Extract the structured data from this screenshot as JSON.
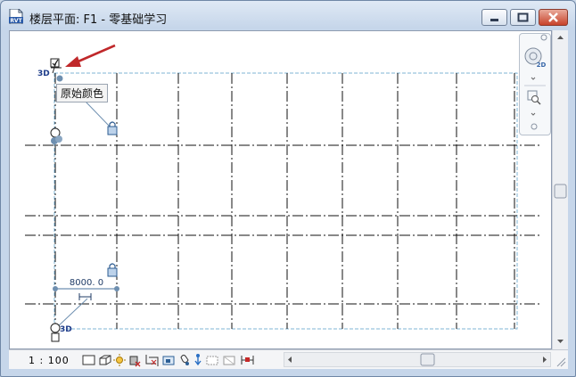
{
  "window": {
    "title": "楼层平面: F1 - 零基础学习",
    "app_icon_label": "RVT",
    "minimize_icon": "minimize-icon",
    "maximize_icon": "maximize-icon",
    "close_icon": "close-icon"
  },
  "canvas": {
    "tooltip_text": "原始颜色",
    "top_view_tag": "3D",
    "bottom_view_tag": "3D",
    "dimension_value": "8000. 0",
    "arrow_color": "#c0282a",
    "grid_color": "#111111",
    "crop_color": "#7fb4d6",
    "handle_color": "#6e8fb0"
  },
  "nav_bar": {
    "wheel_label": "2D",
    "wheel_icon": "steering-wheel-icon",
    "zoom_icon": "zoom-icon"
  },
  "status_bar": {
    "scale": "1 : 100",
    "tools": [
      "detail-level-icon",
      "visual-style-icon",
      "sun-path-icon",
      "shadows-icon",
      "crop-view-icon",
      "show-crop-region-icon",
      "unlock-3d-view-icon",
      "temporary-hide-icon",
      "reveal-hidden-icon",
      "temporary-view-properties-icon",
      "analysis-display-icon",
      "highlight-displacement-icon"
    ]
  }
}
